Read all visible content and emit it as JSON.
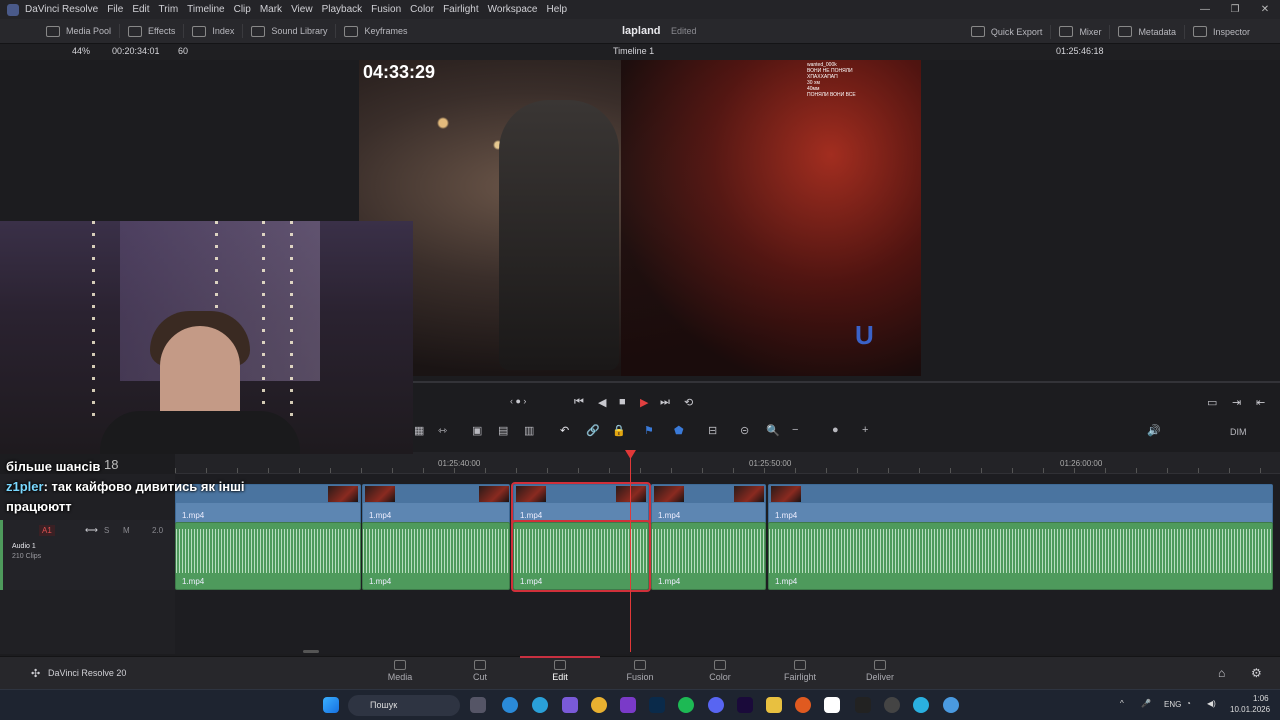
{
  "titlebar": {
    "menus": [
      "DaVinci Resolve",
      "File",
      "Edit",
      "Trim",
      "Timeline",
      "Clip",
      "Mark",
      "View",
      "Playback",
      "Fusion",
      "Color",
      "Fairlight",
      "Workspace",
      "Help"
    ]
  },
  "toolbar": {
    "media_pool": "Media Pool",
    "effects": "Effects",
    "index": "Index",
    "sound_library": "Sound Library",
    "keyframes": "Keyframes",
    "project_name": "lapland",
    "edited": "Edited",
    "quick_export": "Quick Export",
    "mixer": "Mixer",
    "metadata": "Metadata",
    "inspector": "Inspector"
  },
  "viewer": {
    "zoom": "44%",
    "source_timecode": "00:20:34:01",
    "fps": "60",
    "timeline_name": "Timeline 1",
    "record_timecode": "01:25:46:18",
    "overlay_time": "04:33:29",
    "chat": [
      "wanted_000k",
      "ВОНИ НЕ ПОНЯЛИ",
      "ХПАХХАПАП",
      "30 хм",
      "40мм",
      "ПОНЯЛИ ВОНИ ВСЕ"
    ]
  },
  "timeline": {
    "ruler": [
      "01:25:40:00",
      "01:25:50:00",
      "01:26:00:00"
    ],
    "partial_timecode": "18",
    "audio_track_name": "Audio 1",
    "audio_track_clips": "210 Clips",
    "audio_track_id": "A1",
    "audio_level": "2.0",
    "audio_buttons": [
      "S",
      "M"
    ],
    "dim": "DIM",
    "clip_name": "1.mp4"
  },
  "overlay_text": {
    "line1": "більше шансів",
    "user": "z1pler",
    "line2": ": так кайфово дивитись як інші",
    "line3": "працюютт"
  },
  "pages": {
    "brand": "DaVinci Resolve 20",
    "items": [
      "Media",
      "Cut",
      "Edit",
      "Fusion",
      "Color",
      "Fairlight",
      "Deliver"
    ],
    "active": "Edit"
  },
  "taskbar": {
    "search": "Пошук",
    "lang": "ENG",
    "time": "1:06",
    "date": "10.01.2026"
  }
}
